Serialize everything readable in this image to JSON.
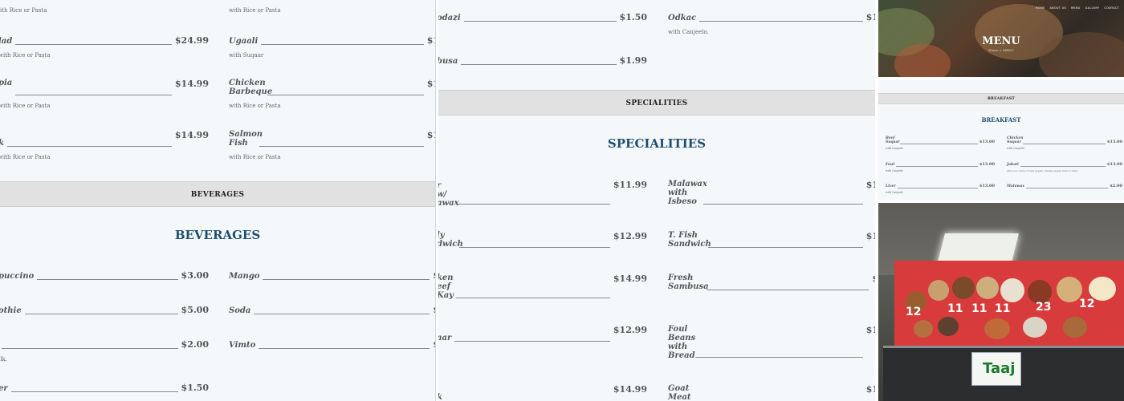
{
  "panel1": {
    "items_top": [
      {
        "name": "",
        "price": "",
        "desc": "with Rice or Pasta"
      },
      {
        "name": "",
        "price": "",
        "desc": "with Rice or Pasta"
      },
      {
        "name": "lad",
        "price": "$24.99",
        "desc": "with Rice or Pasta"
      },
      {
        "name": "Ugaali",
        "price": "$1",
        "desc": "with Suqaar"
      },
      {
        "name": "pia",
        "price": "$14.99",
        "desc": "with Rice or Pasta"
      },
      {
        "name": "Chicken Barbeque",
        "price": "$1",
        "desc": "with Rice or Pasta"
      },
      {
        "name": "k",
        "price": "$14.99",
        "desc": "with Rice or Pasta"
      },
      {
        "name": "Salmon Fish",
        "price": "$1",
        "desc": "with Rice or Pasta"
      }
    ],
    "band": "BEVERAGES",
    "section_title": "BEVERAGES",
    "beverages": [
      {
        "name": "puccino",
        "price": "$3.00",
        "desc": ""
      },
      {
        "name": "Mango",
        "price": "$",
        "desc": ""
      },
      {
        "name": "othie",
        "price": "$5.00",
        "desc": ""
      },
      {
        "name": "Soda",
        "price": "$",
        "desc": ""
      },
      {
        "name": "",
        "price": "$2.00",
        "desc": "ilk."
      },
      {
        "name": "Vimto",
        "price": "$",
        "desc": ""
      },
      {
        "name": "er",
        "price": "$1.50",
        "desc": ""
      }
    ]
  },
  "panel2": {
    "items_top": [
      {
        "name": "odazi",
        "price": "$1.50",
        "desc": ""
      },
      {
        "name": "Odkac",
        "price": "$1",
        "desc": "with Canjeelo."
      },
      {
        "name": "busa",
        "price": "$1.99",
        "desc": ""
      }
    ],
    "band": "SPECIALITIES",
    "section_title": "SPECIALITIES",
    "specialities": [
      {
        "name": "r w/ awax",
        "price": "$11.99"
      },
      {
        "name": "Malawax with Isbeso",
        "price": "$1"
      },
      {
        "name": "ly dwich",
        "price": "$12.99"
      },
      {
        "name": "T. Fish Sandwich",
        "price": "$1"
      },
      {
        "name": "ken eef Kay",
        "price": "$14.99"
      },
      {
        "name": "Fresh Sambusa",
        "price": "$"
      },
      {
        "name": "aar",
        "price": "$12.99"
      },
      {
        "name": "Foul Beans with Bread",
        "price": "$1"
      },
      {
        "name": "k",
        "price": "$14.99"
      },
      {
        "name": "Goat Meat",
        "price": "$1"
      }
    ]
  },
  "panel3": {
    "nav": [
      "HOME",
      "ABOUT US",
      "MENU",
      "GALLERY",
      "CONTACT"
    ],
    "hero_title": "MENU",
    "hero_crumb": "Home > MENU",
    "band": "BREAKFAST",
    "section_title": "BREAKFAST",
    "items": [
      {
        "name": "Beef Suqaar",
        "price": "$13.00",
        "desc": "with Canjeelo"
      },
      {
        "name": "Chicken Suqaar",
        "price": "$13.00",
        "desc": "with Canjeelo"
      },
      {
        "name": "Foul",
        "price": "$13.00",
        "desc": "with Canjeelo"
      },
      {
        "name": "Jabati",
        "price": "$13.00",
        "desc": "with your choice of beef suqaar, chicken suqaar, liver or other"
      },
      {
        "name": "Liver",
        "price": "$13.00",
        "desc": "with Canjeelo"
      },
      {
        "name": "Malawax",
        "price": "$2.00",
        "desc": ""
      }
    ],
    "photo": {
      "numbers": [
        "12",
        "11",
        "11",
        "11",
        "23",
        "12"
      ],
      "sign": "Taaj"
    }
  }
}
